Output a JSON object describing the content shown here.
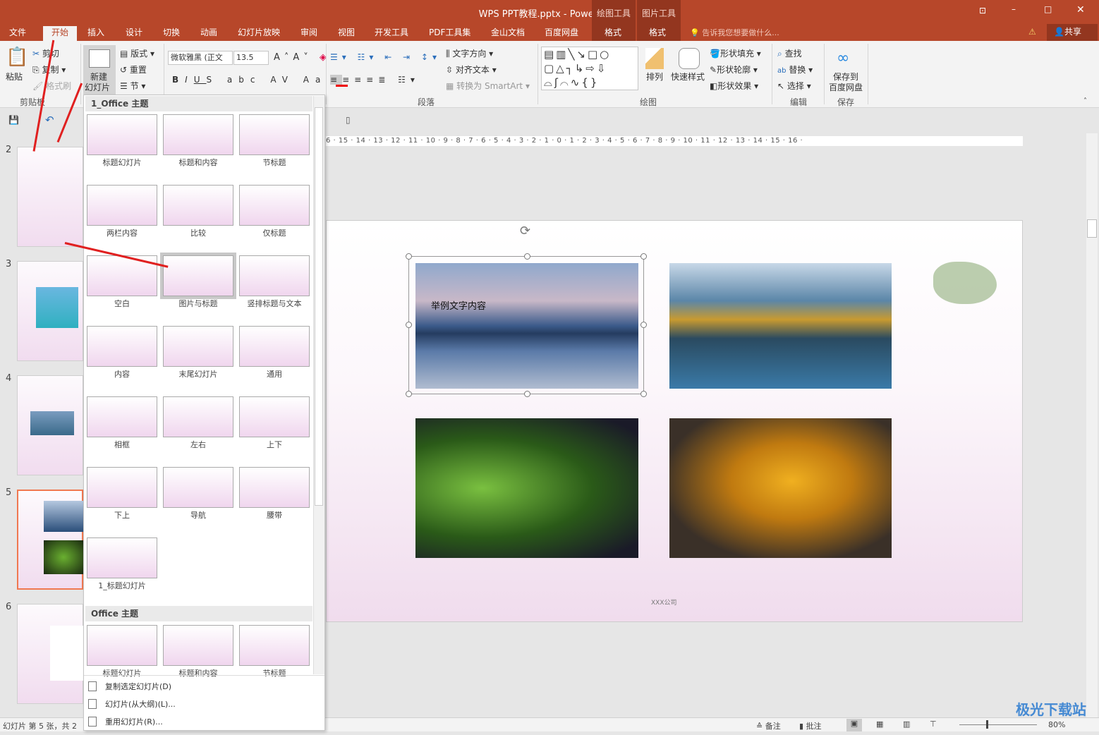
{
  "window": {
    "title": "WPS PPT教程.pptx - PowerPoint",
    "context_tabs": [
      {
        "group": "绘图工具",
        "tab": "格式"
      },
      {
        "group": "图片工具",
        "tab": "格式"
      }
    ],
    "tell_me": "告诉我您想要做什么...",
    "share": "共享"
  },
  "tabs": [
    "文件",
    "开始",
    "插入",
    "设计",
    "切换",
    "动画",
    "幻灯片放映",
    "审阅",
    "视图",
    "开发工具",
    "PDF工具集",
    "金山文档",
    "百度网盘"
  ],
  "active_tab": "开始",
  "ribbon": {
    "clipboard": {
      "paste": "粘贴",
      "cut": "剪切",
      "copy": "复制",
      "format_painter": "格式刷",
      "group": "剪贴板"
    },
    "slides": {
      "new_slide": "新建",
      "new_slide2": "幻灯片",
      "layout": "版式",
      "reset": "重置",
      "section": "节"
    },
    "font": {
      "name": "微软雅黑 (正文",
      "size": "13.5"
    },
    "paragraph": {
      "text_direction": "文字方向",
      "align_text": "对齐文本",
      "smartart": "转换为 SmartArt",
      "group": "段落"
    },
    "drawing": {
      "arrange": "排列",
      "quick_styles": "快速样式",
      "shape_fill": "形状填充",
      "shape_outline": "形状轮廓",
      "shape_effects": "形状效果",
      "group": "绘图"
    },
    "editing": {
      "find": "查找",
      "replace": "替换",
      "select": "选择",
      "group": "编辑"
    },
    "save": {
      "label1": "保存到",
      "label2": "百度网盘",
      "group": "保存"
    }
  },
  "thumbnails": [
    {
      "num": "2"
    },
    {
      "num": "3"
    },
    {
      "num": "4"
    },
    {
      "num": "5"
    },
    {
      "num": "6"
    }
  ],
  "dropdown": {
    "section1": "1_Office 主题",
    "layouts1": [
      "标题幻灯片",
      "标题和内容",
      "节标题",
      "两栏内容",
      "比较",
      "仅标题",
      "空白",
      "图片与标题",
      "竖排标题与文本",
      "内容",
      "末尾幻灯片",
      "通用",
      "相框",
      "左右",
      "上下",
      "下上",
      "导航",
      "腰带",
      "1_标题幻灯片"
    ],
    "selected": "图片与标题",
    "section2": "Office 主题",
    "layouts2": [
      "标题幻灯片",
      "标题和内容",
      "节标题"
    ],
    "menu": [
      "复制选定幻灯片(D)",
      "幻灯片(从大纲)(L)...",
      "重用幻灯片(R)..."
    ]
  },
  "ruler": "6 · 15 · 14 · 13 · 12 · 11 · 10 · 9 · 8 · 7 · 6 · 5 · 4 · 3 · 2 · 1 · 0 · 1 · 2 · 3 · 4 · 5 · 6 · 7 · 8 · 9 · 10 · 11 · 12 · 13 · 14 · 15 · 16 ·",
  "slide": {
    "caption": "举例文字内容",
    "footer": "XXX公司"
  },
  "status": {
    "slide_info": "幻灯片 第 5 张，共 2",
    "notes": "备注",
    "comments": "批注",
    "zoom": "80%"
  },
  "watermark": "极光下载站",
  "colors": {
    "accent": "#b7472a",
    "selection": "#f07850"
  }
}
